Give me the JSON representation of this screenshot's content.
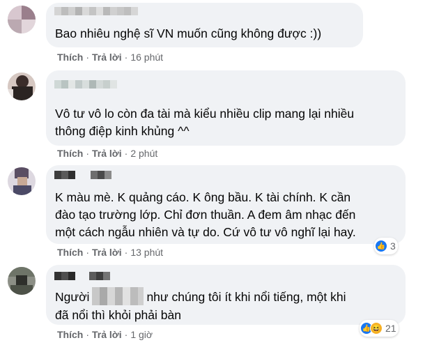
{
  "comments": [
    {
      "text": "Bao nhiêu nghệ sĩ VN muốn cũng không được :))",
      "like_label": "Thích",
      "reply_label": "Trả lời",
      "time": "16 phút",
      "dot": "·"
    },
    {
      "text": "Vô tư vô lo còn đa tài mà kiểu nhiều clip mang lại nhiều\nthông điệp kinh khủng ^^",
      "like_label": "Thích",
      "reply_label": "Trả lời",
      "time": "2 phút",
      "dot": "·"
    },
    {
      "text": "K màu mè. K quảng cáo. K ông bầu. K tài chính. K cần\nđào tạo trường lớp. Chỉ đơn thuần. A đem âm nhạc đến\nmột cách ngẫu nhiên và tự do. Cứ vô tư vô nghĩ lại hay.",
      "like_label": "Thích",
      "reply_label": "Trả lời",
      "time": "13 phút",
      "dot": "·",
      "reaction_count": "3",
      "reaction_icons": [
        "like-icon"
      ]
    },
    {
      "text_start": "Người",
      "text_rest": "như chúng tôi ít khi nổi tiếng, một khi",
      "text_line2": "đã nổi thì khỏi phải bàn",
      "like_label": "Thích",
      "reply_label": "Trả lời",
      "time": "1 giờ",
      "dot": "·",
      "reaction_count": "21",
      "reaction_icons": [
        "like-icon",
        "haha-icon"
      ]
    }
  ],
  "colors": {
    "bubble": "#f0f2f5",
    "meta_text": "#65676b",
    "like_blue": "#1877f2",
    "haha_yellow": "#f7b125"
  }
}
